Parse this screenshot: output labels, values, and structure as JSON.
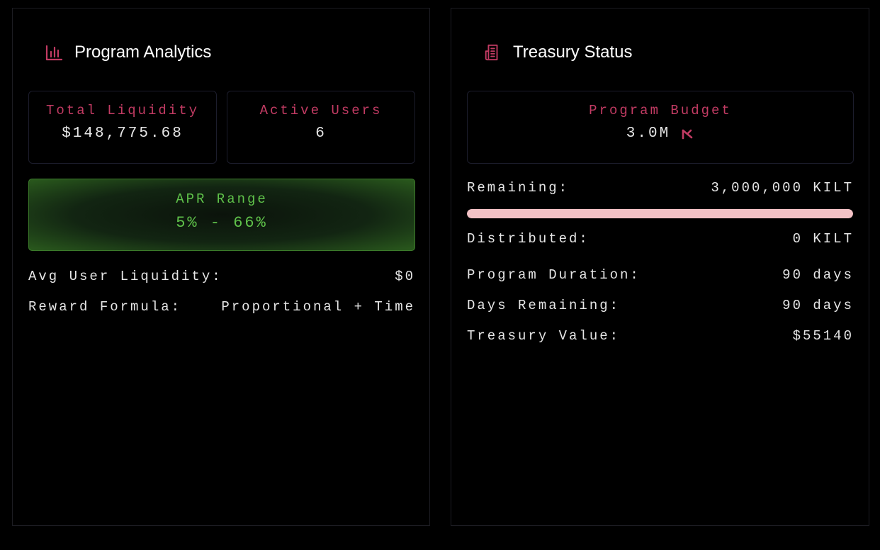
{
  "analytics": {
    "title": "Program Analytics",
    "icon": "bar-chart-icon",
    "total_liquidity": {
      "label": "Total Liquidity",
      "value": "$148,775.68"
    },
    "active_users": {
      "label": "Active Users",
      "value": "6"
    },
    "apr": {
      "label": "APR Range",
      "value": "5% - 66%"
    },
    "rows": [
      {
        "label": "Avg User Liquidity:",
        "value": "$0"
      },
      {
        "label": "Reward Formula:",
        "value": "Proportional + Time"
      }
    ]
  },
  "treasury": {
    "title": "Treasury Status",
    "icon": "receipt-icon",
    "budget": {
      "label": "Program Budget",
      "value": "3.0M",
      "token_icon": "kilt-token-icon"
    },
    "remaining": {
      "label": "Remaining:",
      "value": "3,000,000 KILT"
    },
    "progress_fraction": 1.0,
    "distributed": {
      "label": "Distributed:",
      "value": "0 KILT"
    },
    "rows": [
      {
        "label": "Program Duration:",
        "value": "90 days"
      },
      {
        "label": "Days Remaining:",
        "value": "90 days"
      },
      {
        "label": "Treasury Value:",
        "value": "$55140"
      }
    ]
  },
  "colors": {
    "accent": "#c23b63",
    "green": "#5fc24a",
    "progress": "#f3c2c6"
  }
}
